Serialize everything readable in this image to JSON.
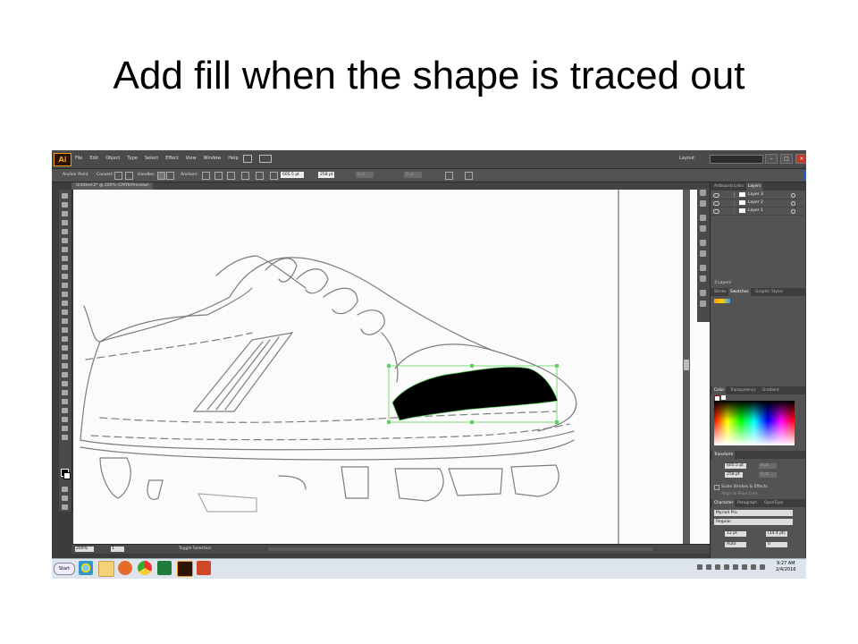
{
  "slide": {
    "title": "Add fill when the shape is traced out"
  },
  "app": {
    "logo": "Ai",
    "menus": [
      "File",
      "Edit",
      "Object",
      "Type",
      "Select",
      "Effect",
      "View",
      "Window",
      "Help"
    ],
    "workspace": "Layout",
    "window_controls": [
      "–",
      "□",
      "×"
    ]
  },
  "control_bar": {
    "anchor_point": "Anchor Point",
    "convert": "Convert:",
    "handles": "Handles:",
    "anchors": "Anchors:",
    "x_value": "605.5 pt",
    "y_value": "258 pt",
    "w_value": "0 pt",
    "h_value": "0 pt"
  },
  "document": {
    "tab": "Untitled-2* @ 200% (CMYK/Preview)"
  },
  "status_bar": {
    "zoom": "200%",
    "page": "1",
    "status": "Toggle Selection"
  },
  "layers_panel": {
    "tabs": [
      "Artboards",
      "Links",
      "Layers"
    ],
    "active_tab": "Layers",
    "layers": [
      {
        "name": "Layer 3",
        "color": "#4aa84a"
      },
      {
        "name": "Layer 2",
        "color": "#d23d3d"
      },
      {
        "name": "Layer 1",
        "color": "#3a64c8"
      }
    ],
    "count": "3 Layers"
  },
  "swatches_panel": {
    "tabs": [
      "Stroke",
      "Swatches",
      "Graphic Styles"
    ],
    "active_tab": "Swatches"
  },
  "color_panel": {
    "tabs": [
      "Color",
      "Transparency",
      "Gradient"
    ],
    "active_tab": "Color"
  },
  "transform_panel": {
    "title": "Transform",
    "x": "605.5 pt",
    "y": "258 pt",
    "w": "0 pt",
    "h": "0 pt",
    "scale_strokes": "Scale Strokes & Effects",
    "align_pixel": "Align to Pixel Grid"
  },
  "character_panel": {
    "tabs": [
      "Character",
      "Paragraph",
      "OpenType"
    ],
    "font": "Myriad Pro",
    "style": "Regular",
    "size": "12 pt",
    "leading": "(14.4 pt)",
    "kerning": "Auto",
    "tracking": "0"
  },
  "taskbar": {
    "start": "Start",
    "time": "9:27 AM",
    "date": "2/4/2016",
    "apps": [
      "ie-icon",
      "folder-icon",
      "media-icon",
      "chrome-icon",
      "excel-icon",
      "illustrator-icon",
      "powerpoint-icon"
    ]
  },
  "colors": {
    "accent": "#f29a1a",
    "selection": "#5dd35d",
    "fill": "#000000"
  }
}
